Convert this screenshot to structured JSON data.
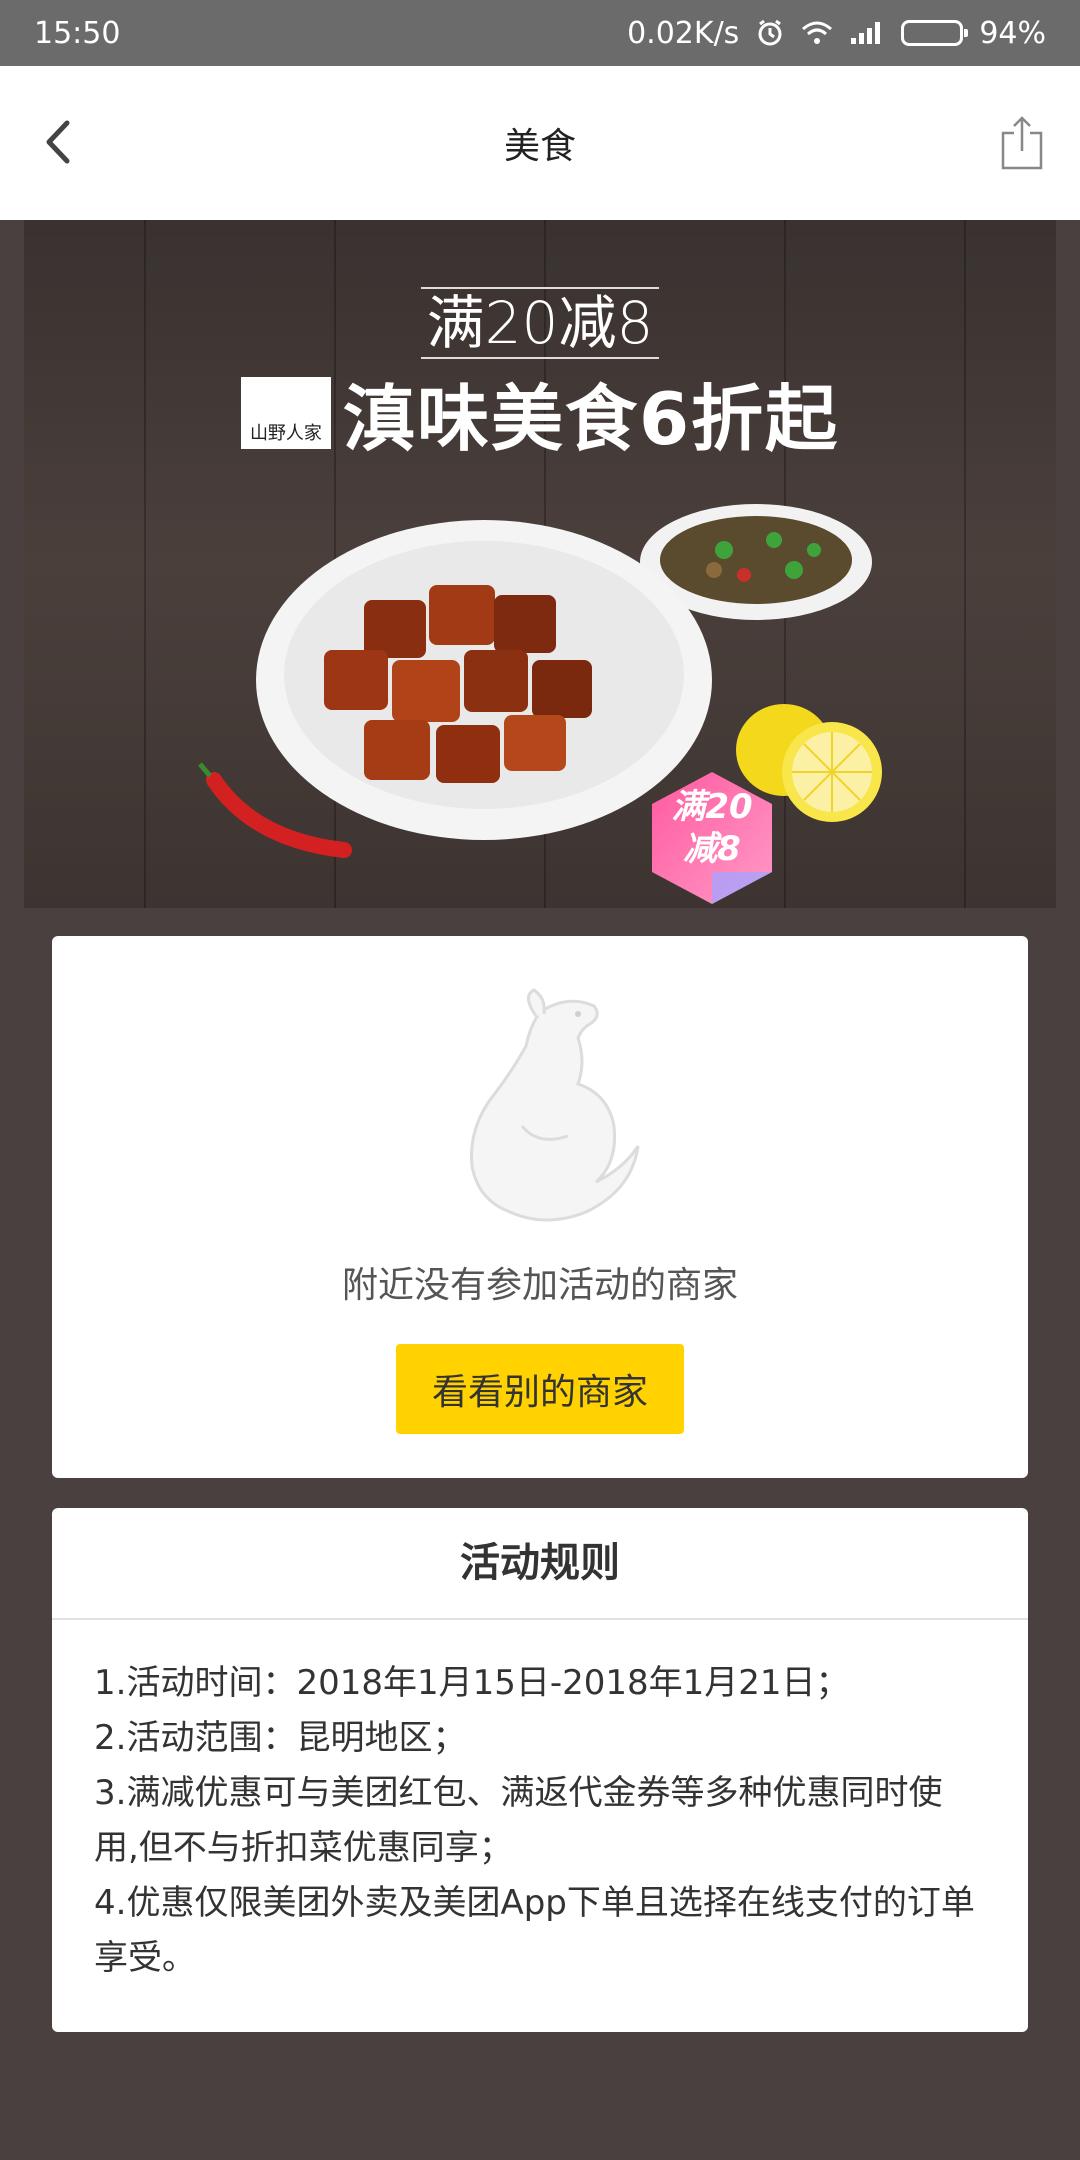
{
  "status_bar": {
    "time": "15:50",
    "network_speed": "0.02K/s",
    "battery": "94%",
    "battery_level": 0.94
  },
  "nav": {
    "title": "美食"
  },
  "banner": {
    "promo_top": "满20减8",
    "headline": "滇味美食6折起",
    "brand": "山野人家",
    "badge_line1": "满20",
    "badge_line2": "减8"
  },
  "empty_state": {
    "message": "附近没有参加活动的商家",
    "button_label": "看看别的商家"
  },
  "rules": {
    "title": "活动规则",
    "items": [
      "1.活动时间：2018年1月15日-2018年1月21日；",
      "2.活动范围：昆明地区；",
      "3.满减优惠可与美团红包、满返代金券等多种优惠同时使用,但不与折扣菜优惠同享；",
      "4.优惠仅限美团外卖及美团App下单且选择在线支付的订单享受。"
    ]
  },
  "colors": {
    "background": "#4a4040",
    "accent_button": "#ffd200",
    "badge": "#ff6fa8"
  }
}
